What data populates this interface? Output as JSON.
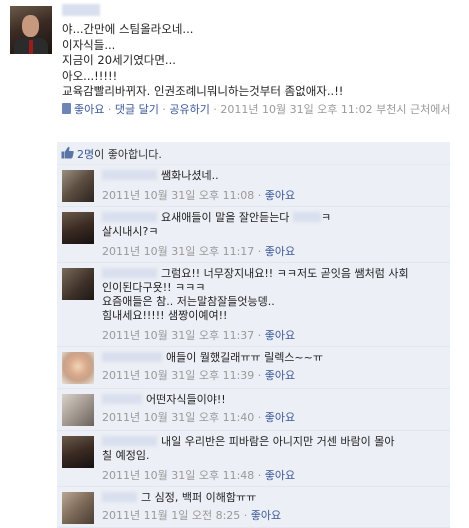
{
  "post": {
    "lines": [
      "야...간만에 스팀올라오네...",
      "이자식들...",
      "지금이 20세기였다면...",
      "아오...!!!!!",
      "교육감빨리바뀌자. 인권조례니뭐니하는것부터 좀없애자..!!"
    ],
    "meta": {
      "like": "좋아요",
      "sep1": " · ",
      "comment": "댓글 달기",
      "sep2": " · ",
      "share": "공유하기",
      "sep3": " · ",
      "time": "2011년 10월 31일 오후 11:02",
      "location": " 부천시 근처에서",
      "sep4": " · "
    }
  },
  "likes": {
    "count": "2명",
    "suffix": "이 좋아합니다."
  },
  "comments": [
    {
      "text": "쌤화나셨네..",
      "time": "2011년 10월 31일 오후 11:08",
      "like": "좋아요"
    },
    {
      "text": "요새애들이 말을 잘안듣는다 ",
      "text2": "ㅋ",
      "line2": "살시내시?ㅋ",
      "time": "2011년 10월 31일 오후 11:17",
      "like": "좋아요"
    },
    {
      "text": "그럼요!! 너무장지내요!! ㅋㅋ저도 곧잇음 쌤처럼 사회",
      "line2": "인이된다구욧!! ㅋㅋㅋ",
      "line3": "요즘애들은 참.. 저는말참잘들엇능뎅..",
      "line4": "힘내세요!!!!! 샘짱이예여!!",
      "time": "2011년 10월 31일 오후 11:37",
      "like": "좋아요"
    },
    {
      "text": "애들이 뭘했길래ㅠㅠ 릴렉스~~ㅠ",
      "time": "2011년 10월 31일 오후 11:39",
      "like": "좋아요"
    },
    {
      "text": "어떤자식들이야!!",
      "time": "2011년 10월 31일 오후 11:40",
      "like": "좋아요"
    },
    {
      "text": "내일 우리반은 피바람은 아니지만 거센 바람이 몰아",
      "line2": "칠 예정임.",
      "time": "2011년 10월 31일 오후 11:48",
      "like": "좋아요"
    },
    {
      "text": "그 심정, 백퍼 이해함ㅠㅠ",
      "time": "2011년 11월 1일 오전 8:25",
      "like": "좋아요"
    }
  ]
}
